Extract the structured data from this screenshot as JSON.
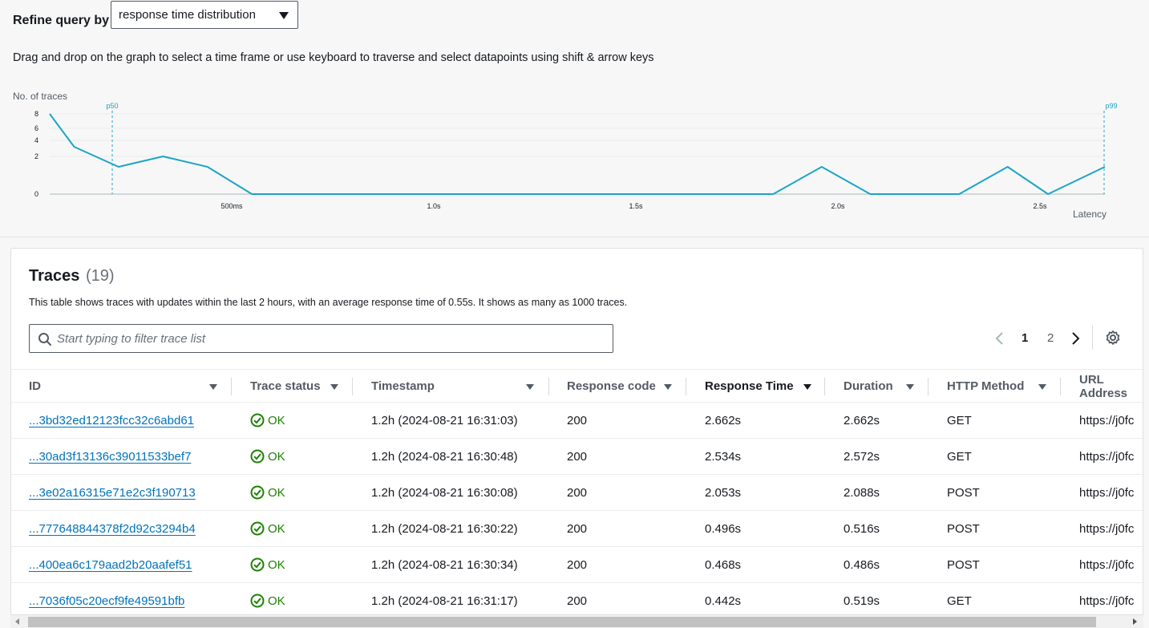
{
  "refine": {
    "label": "Refine query by",
    "selected": "response time distribution"
  },
  "instructions": "Drag and drop on the graph to select a time frame or use keyboard to traverse and select datapoints using shift & arrow keys",
  "chart_data": {
    "type": "line",
    "ylabel": "No. of traces",
    "xlabel": "Latency",
    "y_ticks": [
      "0",
      "2",
      "4",
      "6",
      "8"
    ],
    "x_ticks": [
      "500ms",
      "1.0s",
      "1.5s",
      "2.0s",
      "2.5s"
    ],
    "percentile_markers": [
      {
        "label": "p50",
        "x": 0.17
      },
      {
        "label": "p99",
        "x": 2.66
      }
    ],
    "series": [
      {
        "x": [
          0.0,
          0.11,
          0.22,
          0.33,
          0.44,
          0.55,
          1.84,
          1.96,
          2.08,
          2.3,
          2.42,
          2.52,
          2.66
        ],
        "y": [
          8,
          3,
          1,
          2,
          1,
          0,
          0,
          1,
          0,
          0,
          1,
          0,
          1
        ]
      }
    ],
    "color": "#1ba5c8"
  },
  "traces": {
    "title": "Traces",
    "count": "(19)",
    "description": "This table shows traces with updates within the last 2 hours, with an average response time of 0.55s. It shows as many as 1000 traces.",
    "search_placeholder": "Start typing to filter trace list",
    "pagination": {
      "page1": "1",
      "page2": "2"
    },
    "columns": [
      "ID",
      "Trace status",
      "Timestamp",
      "Response code",
      "Response Time",
      "Duration",
      "HTTP Method",
      "URL Address"
    ],
    "rows": [
      {
        "id": "...3bd32ed12123fcc32c6abd61",
        "status": "OK",
        "timestamp": "1.2h (2024-08-21 16:31:03)",
        "code": "200",
        "response_time": "2.662s",
        "duration": "2.662s",
        "method": "GET",
        "url": "https://j0fc"
      },
      {
        "id": "...30ad3f13136c39011533bef7",
        "status": "OK",
        "timestamp": "1.2h (2024-08-21 16:30:48)",
        "code": "200",
        "response_time": "2.534s",
        "duration": "2.572s",
        "method": "GET",
        "url": "https://j0fc"
      },
      {
        "id": "...3e02a16315e71e2c3f190713",
        "status": "OK",
        "timestamp": "1.2h (2024-08-21 16:30:08)",
        "code": "200",
        "response_time": "2.053s",
        "duration": "2.088s",
        "method": "POST",
        "url": "https://j0fc"
      },
      {
        "id": "...777648844378f2d92c3294b4",
        "status": "OK",
        "timestamp": "1.2h (2024-08-21 16:30:22)",
        "code": "200",
        "response_time": "0.496s",
        "duration": "0.516s",
        "method": "POST",
        "url": "https://j0fc"
      },
      {
        "id": "...400ea6c179aad2b20aafef51",
        "status": "OK",
        "timestamp": "1.2h (2024-08-21 16:30:34)",
        "code": "200",
        "response_time": "0.468s",
        "duration": "0.486s",
        "method": "POST",
        "url": "https://j0fc"
      },
      {
        "id": "...7036f05c20ecf9fe49591bfb",
        "status": "OK",
        "timestamp": "1.2h (2024-08-21 16:31:17)",
        "code": "200",
        "response_time": "0.442s",
        "duration": "0.519s",
        "method": "GET",
        "url": "https://j0fc"
      }
    ]
  }
}
